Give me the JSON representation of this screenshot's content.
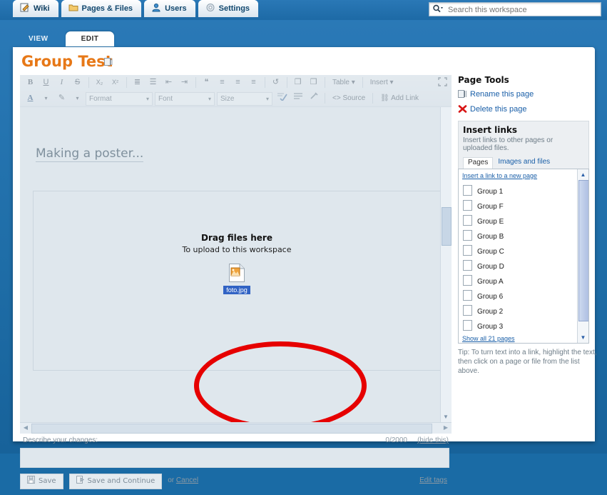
{
  "nav": {
    "tabs": [
      {
        "label": "Wiki",
        "icon": "pencil-page-icon",
        "active": true
      },
      {
        "label": "Pages & Files",
        "icon": "folder-icon",
        "active": false
      },
      {
        "label": "Users",
        "icon": "user-icon",
        "active": false
      },
      {
        "label": "Settings",
        "icon": "gear-icon",
        "active": false
      }
    ],
    "search": {
      "placeholder": "Search this workspace",
      "value": "",
      "icon": "search-icon"
    }
  },
  "view_tabs": [
    {
      "label": "VIEW",
      "active": false
    },
    {
      "label": "EDIT",
      "active": true
    }
  ],
  "page": {
    "title": "Group Test",
    "rename_icon": "rename-page-icon"
  },
  "toolbar": {
    "row1": [
      {
        "name": "bold",
        "glyph": "B"
      },
      {
        "name": "underline",
        "glyph": "U"
      },
      {
        "name": "italic",
        "glyph": "I"
      },
      {
        "name": "strikethrough",
        "glyph": "S"
      },
      {
        "name": "subscript",
        "glyph": "X₂"
      },
      {
        "name": "superscript",
        "glyph": "X²"
      },
      {
        "name": "numbered-list",
        "glyph": "≣"
      },
      {
        "name": "bulleted-list",
        "glyph": "☰"
      },
      {
        "name": "decrease-indent",
        "glyph": "⇤"
      },
      {
        "name": "increase-indent",
        "glyph": "⇥"
      },
      {
        "name": "blockquote",
        "glyph": "❝"
      },
      {
        "name": "align-left",
        "glyph": "≡"
      },
      {
        "name": "align-center",
        "glyph": "≡"
      },
      {
        "name": "align-right",
        "glyph": "≡"
      },
      {
        "name": "undo",
        "glyph": "↺"
      },
      {
        "name": "copy",
        "glyph": "❐"
      },
      {
        "name": "paste",
        "glyph": "❒"
      }
    ],
    "table_label": "Table",
    "insert_label": "Insert",
    "maximize_icon": "maximize-icon",
    "row2": {
      "text_color": "A",
      "bg_color": "✎",
      "format_label": "Format",
      "font_label": "Font",
      "size_label": "Size",
      "spellcheck_icon": "spellcheck-icon",
      "horizontal_rule_icon": "horizontal-rule-icon",
      "remove_format_icon": "remove-format-icon",
      "source_label": "Source",
      "addlink_label": "Add Link"
    }
  },
  "editor": {
    "body_text": "Making a poster...",
    "dropzone": {
      "title": "Drag files here",
      "subtitle": "To upload to this workspace",
      "file": {
        "name": "foto.jpg",
        "icon": "image-file-icon",
        "selected": true
      }
    },
    "annotation": {
      "shape": "ellipse",
      "color": "#e60000"
    }
  },
  "describe": {
    "label": "Describe your changes:",
    "char_count": "0/2000",
    "hide_link": "(hide this)",
    "value": ""
  },
  "actions": {
    "save_label": "Save",
    "save_icon": "save-disk-icon",
    "save_continue_label": "Save and Continue",
    "save_continue_icon": "save-continue-icon",
    "or_text": "or ",
    "cancel_label": "Cancel",
    "edit_tags_label": "Edit tags"
  },
  "sidebar": {
    "title": "Page Tools",
    "tools": [
      {
        "label": "Rename this page",
        "icon": "rename-icon"
      },
      {
        "label": "Delete this page",
        "icon": "delete-x-icon"
      }
    ],
    "insert_links": {
      "title": "Insert links",
      "subtitle": "Insert links to other pages or uploaded files.",
      "tabs": [
        {
          "label": "Pages",
          "active": true
        },
        {
          "label": "Images and files",
          "active": false
        }
      ],
      "new_page_link": "Insert a link to a new page",
      "pages": [
        {
          "label": "Group 1",
          "icon": "page-icon"
        },
        {
          "label": "Group F",
          "icon": "page-icon"
        },
        {
          "label": "Group E",
          "icon": "page-icon"
        },
        {
          "label": "Group B",
          "icon": "page-icon"
        },
        {
          "label": "Group C",
          "icon": "page-icon"
        },
        {
          "label": "Group D",
          "icon": "page-icon"
        },
        {
          "label": "Group A",
          "icon": "page-icon"
        },
        {
          "label": "Group 6",
          "icon": "page-icon"
        },
        {
          "label": "Group 2",
          "icon": "page-icon"
        },
        {
          "label": "Group 3",
          "icon": "page-icon"
        }
      ],
      "show_all": "Show all 21 pages"
    },
    "tip": "Tip: To turn text into a link, highlight the text, then click on a page or file from the list above."
  },
  "colors": {
    "chrome_blue": "#1f6ea8",
    "title_orange": "#e77817",
    "link_blue": "#1a5fa8",
    "annotation_red": "#e60000",
    "selection_blue": "#3163c4"
  }
}
